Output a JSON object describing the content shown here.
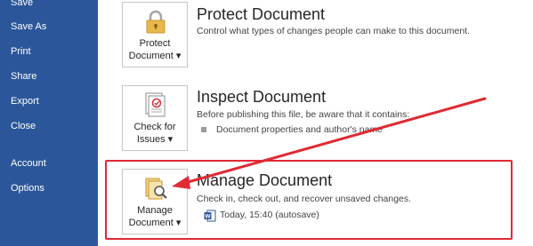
{
  "sidebar": {
    "items": [
      {
        "label": "Save"
      },
      {
        "label": "Save As"
      },
      {
        "label": "Print"
      },
      {
        "label": "Share"
      },
      {
        "label": "Export"
      },
      {
        "label": "Close"
      },
      {
        "label": "Account"
      },
      {
        "label": "Options"
      }
    ]
  },
  "sections": {
    "protect": {
      "button_line1": "Protect",
      "button_line2": "Document ▾",
      "title": "Protect Document",
      "description": "Control what types of changes people can make to this document."
    },
    "inspect": {
      "button_line1": "Check for",
      "button_line2": "Issues ▾",
      "title": "Inspect Document",
      "description": "Before publishing this file, be aware that it contains:",
      "bullet": "Document properties and author's name"
    },
    "manage": {
      "button_line1": "Manage",
      "button_line2": "Document ▾",
      "title": "Manage Document",
      "description": "Check in, check out, and recover unsaved changes.",
      "version": "Today, 15:40 (autosave)"
    }
  },
  "colors": {
    "sidebar_bg": "#2b579a",
    "annotation_red": "#e02a33"
  }
}
